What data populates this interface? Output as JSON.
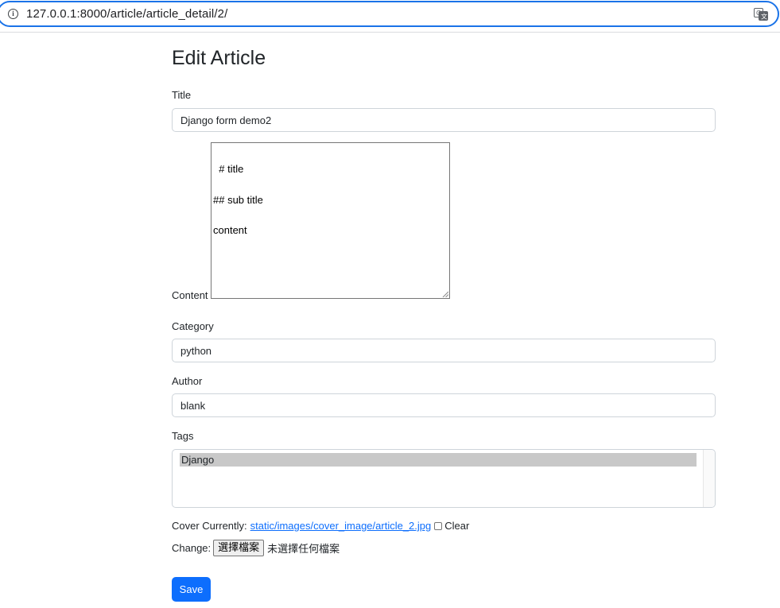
{
  "browser": {
    "url": "127.0.0.1:8000/article/article_detail/2/"
  },
  "page": {
    "heading": "Edit Article"
  },
  "form": {
    "title_label": "Title",
    "title_value": "Django form demo2",
    "content_label": "Content",
    "content_value": "# title\n\n## sub title\n\ncontent",
    "category_label": "Category",
    "category_value": "python",
    "author_label": "Author",
    "author_value": "blank",
    "tags_label": "Tags",
    "tags_selected": "Django",
    "cover_label": "Cover Currently:",
    "cover_link": "static/images/cover_image/article_2.jpg",
    "clear_label": "Clear",
    "change_label": "Change:",
    "file_button": "選擇檔案",
    "file_status": "未選擇任何檔案",
    "save_label": "Save"
  },
  "colors": {
    "primary": "#0d6efd",
    "focus_ring": "#1a73e8"
  }
}
